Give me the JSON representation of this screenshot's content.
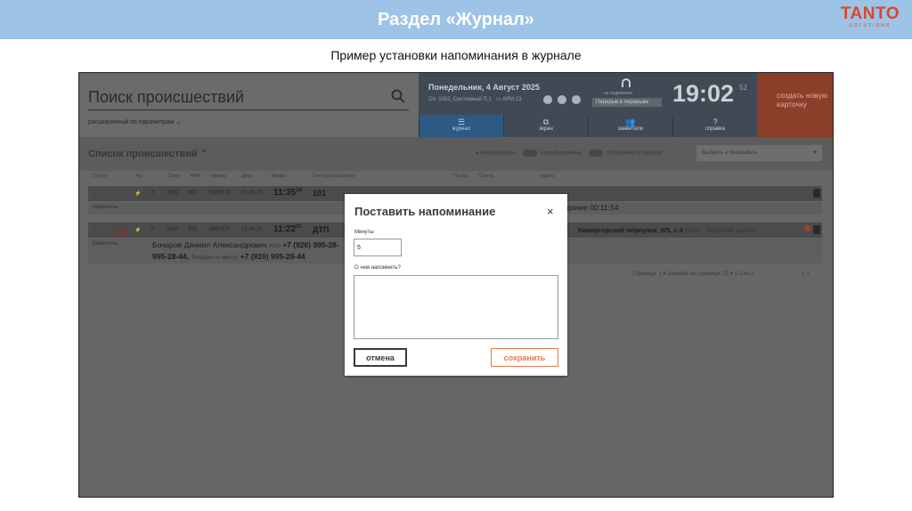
{
  "slide": {
    "title": "Раздел «Журнал»",
    "logo_main": "TANTO",
    "logo_sub": "SOLUTIONS",
    "subtitle": "Пример установки напоминания в журнале"
  },
  "app": {
    "search": {
      "placeholder": "Поиск происшествий",
      "extended": "расширенный по параметрам ⌄"
    },
    "info": {
      "date": "Понедельник, 4 Август 2025",
      "sub": "Оп. 1002, Системный П.1",
      "apm": "АРМ 23",
      "status_label": "не подключен",
      "status_value": "Перерыв в перерыве",
      "clock": "19:02",
      "clock_sec": "52"
    },
    "tabs": [
      {
        "label": "журнал",
        "icon": "☰"
      },
      {
        "label": "экран",
        "icon": "⧉"
      },
      {
        "label": "заявители",
        "icon": "👥"
      },
      {
        "label": "справка",
        "icon": "?"
      }
    ],
    "create_button": "создать новую карточку",
    "list": {
      "title": "Список происшествий ⌃",
      "filter1": "Неоднозначно",
      "filter2": "Автообновление",
      "filter3": "Обращения в очереди",
      "sort_placeholder": "Выбрать и показывать"
    },
    "columns": [
      "Статус",
      "№",
      "Этап",
      "АРМ",
      "Номер",
      "Дата",
      "Время",
      "Тип происшествия",
      "Посты",
      "Статус",
      "Адрес"
    ],
    "rows": [
      {
        "num1": "1502",
        "num2": "902",
        "num3": "5657678",
        "date": "15.05.25",
        "time": "11:35",
        "sec": "14",
        "type": "101",
        "applicant": "Заявитель",
        "elapsed": "Ожидание 00:11:54"
      },
      {
        "go": "GO",
        "num1": "1906",
        "num2": "906",
        "num3": "5657870",
        "date": "15.05.25",
        "time": "11:22",
        "sec": "01",
        "type": "ДТП",
        "address": "Камергерский переулок, 6/5, с.3",
        "address_sub": "(ЦАО, Тверской район)",
        "applicant": "Заявитель",
        "caller_name": "Бочаров Даниил Александрович",
        "caller_tag": "АОН",
        "caller_phone1": "+7 (926) 995-28-",
        "caller_phone1b": "995-28-44,",
        "caller_tag2": "Телефон по месту:",
        "caller_phone2": "+7 (926) 995-28-44"
      }
    ],
    "pager": "Страница: 1  ▾     Записей на странице: 20  ▾     1-2 из 2"
  },
  "modal": {
    "title": "Поставить напоминание",
    "close": "×",
    "minutes_label": "Минуты",
    "minutes_value": "5",
    "remind_label": "О чем напомнить?",
    "remind_value": "",
    "cancel_label": "отмена",
    "save_label": "сохранить"
  },
  "colors": {
    "header_bg": "#9dc3e6",
    "logo": "#d9472b",
    "save_accent": "#e07a4f",
    "create_button_bg": "#8b3f2a",
    "active_tab": "#2b5a85"
  }
}
